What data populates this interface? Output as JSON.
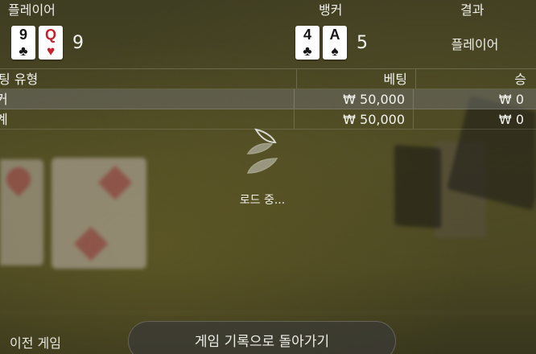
{
  "header": {
    "player_label": "플레이어",
    "banker_label": "뱅커",
    "result_label": "결과"
  },
  "player_hand": {
    "cards": [
      {
        "rank": "9",
        "suit": "♣",
        "color": "#151515"
      },
      {
        "rank": "Q",
        "suit": "♥",
        "color": "#c8202a"
      }
    ],
    "score": "9"
  },
  "banker_hand": {
    "cards": [
      {
        "rank": "4",
        "suit": "♣",
        "color": "#151515"
      },
      {
        "rank": "A",
        "suit": "♠",
        "color": "#151515"
      }
    ],
    "score": "5"
  },
  "result": {
    "value": "플레이어"
  },
  "bets": {
    "columns": [
      "팅 유형",
      "베팅",
      "승"
    ],
    "rows": [
      {
        "type": "커",
        "bet": "₩ 50,000",
        "win": "₩ 0"
      },
      {
        "type": "계",
        "bet": "₩ 50,000",
        "win": "₩ 0"
      }
    ]
  },
  "loading": {
    "text": "로드 중..."
  },
  "footer": {
    "prev_game": "이전 게임",
    "back_button": "게임 기록으로 돌아가기"
  },
  "colors": {
    "red_suit": "#c8202a",
    "black_suit": "#151515",
    "table_felt": "#4d4a24"
  }
}
